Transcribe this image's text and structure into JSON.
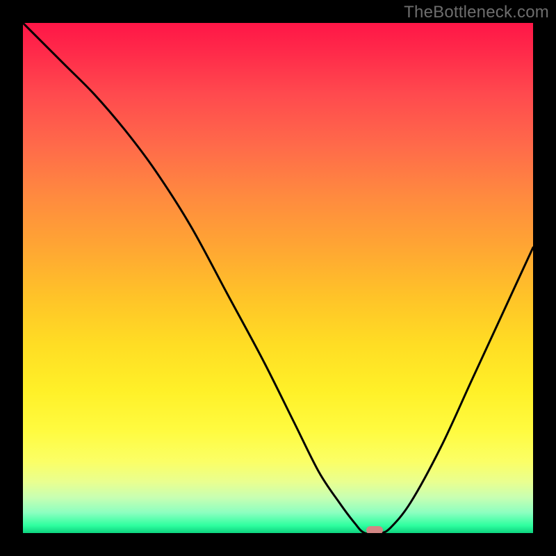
{
  "watermark": "TheBottleneck.com",
  "chart_data": {
    "type": "line",
    "title": "",
    "xlabel": "",
    "ylabel": "",
    "xlim": [
      0,
      100
    ],
    "ylim": [
      0,
      100
    ],
    "grid": false,
    "series": [
      {
        "name": "curve",
        "x": [
          0,
          8,
          14,
          20,
          26,
          33,
          40,
          47,
          53,
          58,
          62,
          65,
          67,
          70,
          72,
          76,
          82,
          88,
          94,
          100
        ],
        "values": [
          100,
          92,
          86,
          79,
          71,
          60,
          47,
          34,
          22,
          12,
          6,
          2,
          0,
          0,
          1,
          6,
          17,
          30,
          43,
          56
        ]
      }
    ],
    "marker": {
      "x": 69,
      "y": 0
    }
  },
  "colors": {
    "background": "#000000",
    "curve": "#000000",
    "marker": "#d38684"
  }
}
